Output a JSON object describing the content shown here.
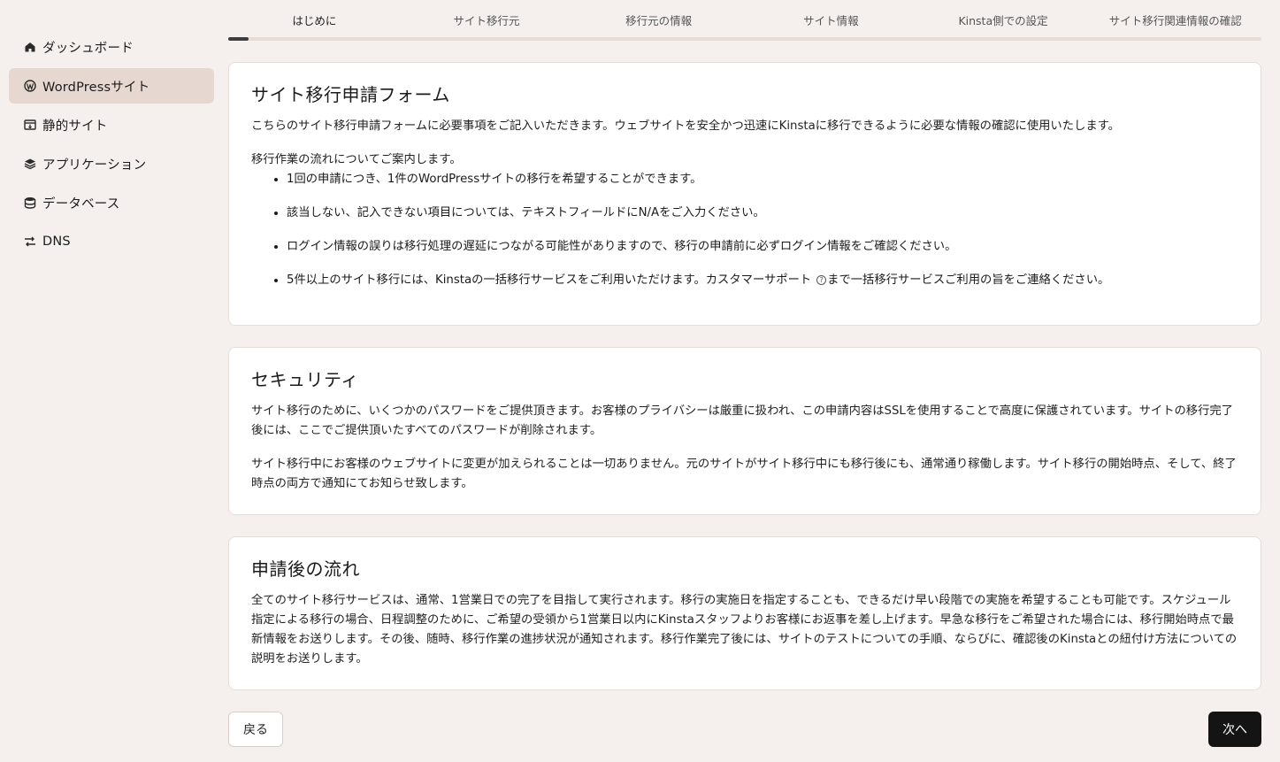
{
  "sidebar": {
    "items": [
      {
        "label": "ダッシュボード",
        "icon": "home-icon"
      },
      {
        "label": "WordPressサイト",
        "icon": "wordpress-icon",
        "active": true
      },
      {
        "label": "静的サイト",
        "icon": "static-site-icon"
      },
      {
        "label": "アプリケーション",
        "icon": "layers-icon"
      },
      {
        "label": "データベース",
        "icon": "database-icon"
      },
      {
        "label": "DNS",
        "icon": "dns-icon"
      }
    ]
  },
  "steps": {
    "items": [
      "はじめに",
      "サイト移行元",
      "移行元の情報",
      "サイト情報",
      "Kinsta側での設定",
      "サイト移行関連情報の確認"
    ],
    "progress": 0.02
  },
  "intro_card": {
    "title": "サイト移行申請フォーム",
    "description": "こちらのサイト移行申請フォームに必要事項をご記入いただきます。ウェブサイトを安全かつ迅速にKinstaに移行できるように必要な情報の確認に使用いたします。",
    "flow_heading": "移行作業の流れについてご案内します。",
    "bullets": [
      "1回の申請につき、1件のWordPressサイトの移行を希望することができます。",
      "該当しない、記入できない項目については、テキストフィールドにN/Aをご入力ください。",
      "ログイン情報の誤りは移行処理の遅延につながる可能性がありますので、移行の申請前に必ずログイン情報をご確認ください。"
    ],
    "last_bullet_before": "5件以上のサイト移行には、Kinstaの一括移行サービスをご利用いただけます。カスタマーサポート",
    "last_bullet_after": "まで一括移行サービスご利用の旨をご連絡ください。"
  },
  "security_card": {
    "title": "セキュリティ",
    "paragraphs": [
      "サイト移行のために、いくつかのパスワードをご提供頂きます。お客様のプライバシーは厳重に扱われ、この申請内容はSSLを使用することで高度に保護されています。サイトの移行完了後には、ここでご提供頂いたすべてのパスワードが削除されます。",
      "サイト移行中にお客様のウェブサイトに変更が加えられることは一切ありません。元のサイトがサイト移行中にも移行後にも、通常通り稼働します。サイト移行の開始時点、そして、終了時点の両方で通知にてお知らせ致します。"
    ]
  },
  "after_card": {
    "title": "申請後の流れ",
    "paragraph": "全てのサイト移行サービスは、通常、1営業日での完了を目指して実行されます。移行の実施日を指定することも、できるだけ早い段階での実施を希望することも可能です。スケジュール指定による移行の場合、日程調整のために、ご希望の受領から1営業日以内にKinstaスタッフよりお客様にお返事を差し上げます。早急な移行をご希望された場合には、移行開始時点で最新情報をお送りします。その後、随時、移行作業の進捗状況が通知されます。移行作業完了後には、サイトのテストについての手順、ならびに、確認後のKinstaとの紐付け方法についての説明をお送りします。"
  },
  "buttons": {
    "back": "戻る",
    "next": "次へ"
  }
}
